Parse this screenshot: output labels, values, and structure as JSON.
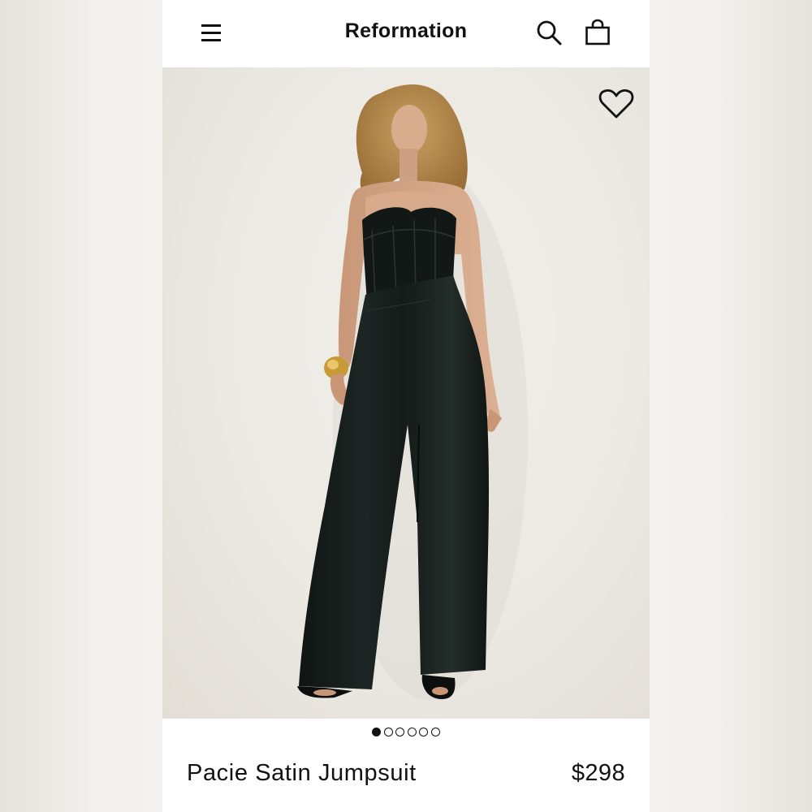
{
  "header": {
    "brand": "Reformation",
    "menu_icon": "hamburger-menu-icon",
    "search_icon": "search-icon",
    "bag_icon": "shopping-bag-icon"
  },
  "gallery": {
    "wishlist_icon": "heart-icon",
    "image_count": 6,
    "active_index": 0
  },
  "product": {
    "name": "Pacie Satin Jumpsuit",
    "price": "$298"
  },
  "colors": {
    "text": "#111111",
    "background": "#ffffff",
    "photo_background": "#ece9e3"
  }
}
